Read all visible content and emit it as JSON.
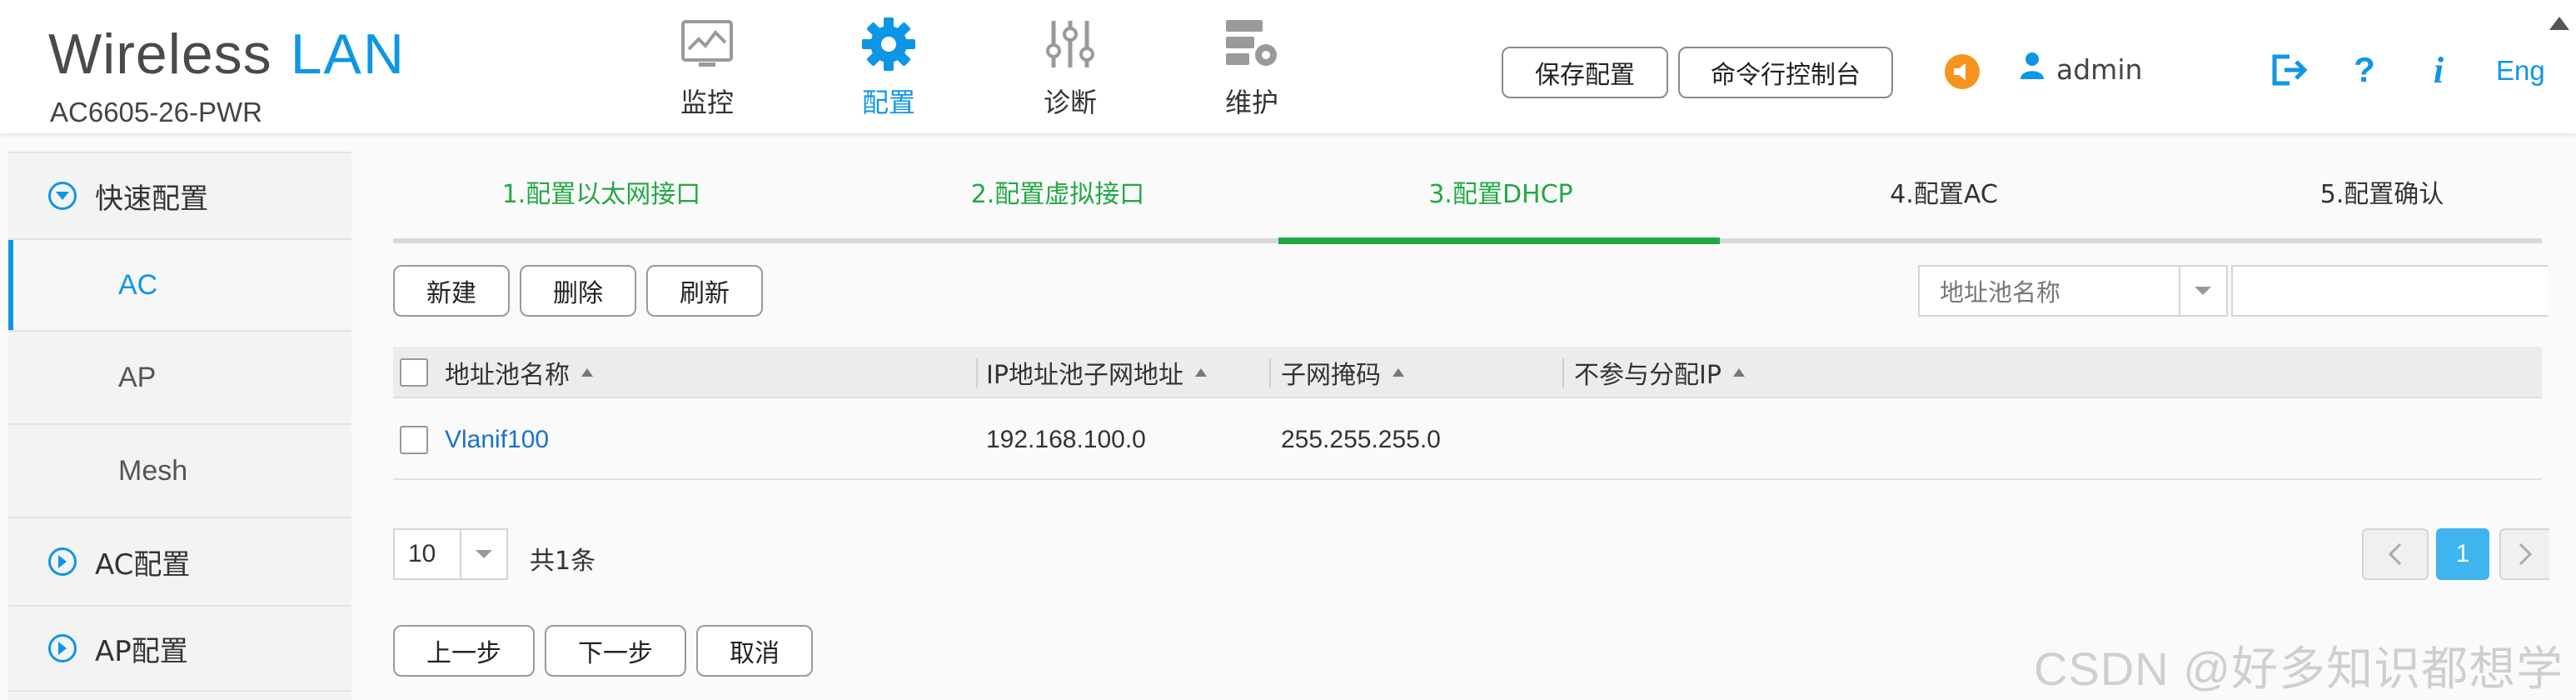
{
  "header": {
    "brand_word": "Wireless",
    "brand_accent": "LAN",
    "model": "AC6605-26-PWR",
    "nav": [
      {
        "label": "监控",
        "icon": "monitor-icon"
      },
      {
        "label": "配置",
        "icon": "gear-icon",
        "active": true
      },
      {
        "label": "诊断",
        "icon": "sliders-icon"
      },
      {
        "label": "维护",
        "icon": "server-gear-icon"
      }
    ],
    "save_label": "保存配置",
    "cli_label": "命令行控制台",
    "user": "admin",
    "lang": "Eng"
  },
  "sidebar": {
    "quick": "快速配置",
    "items": [
      "AC",
      "AP",
      "Mesh"
    ],
    "ac_config": "AC配置",
    "ap_config": "AP配置"
  },
  "steps": [
    "1.配置以太网接口",
    "2.配置虚拟接口",
    "3.配置DHCP",
    "4.配置AC",
    "5.配置确认"
  ],
  "toolbar": {
    "new": "新建",
    "delete": "删除",
    "refresh": "刷新",
    "search_field": "地址池名称"
  },
  "table": {
    "columns": [
      "地址池名称",
      "IP地址池子网地址",
      "子网掩码",
      "不参与分配IP"
    ],
    "rows": [
      {
        "name": "Vlanif100",
        "subnet": "192.168.100.0",
        "mask": "255.255.255.0",
        "excluded": ""
      }
    ]
  },
  "pagination": {
    "page_size": "10",
    "total": "共1条",
    "current": "1"
  },
  "footer": {
    "prev": "上一步",
    "next": "下一步",
    "cancel": "取消"
  },
  "watermark": "CSDN @好多知识都想学",
  "colors": {
    "accent": "#0e96e6",
    "step_done": "#22a845",
    "link": "#1a73c8",
    "page_active": "#3fb4ef"
  }
}
